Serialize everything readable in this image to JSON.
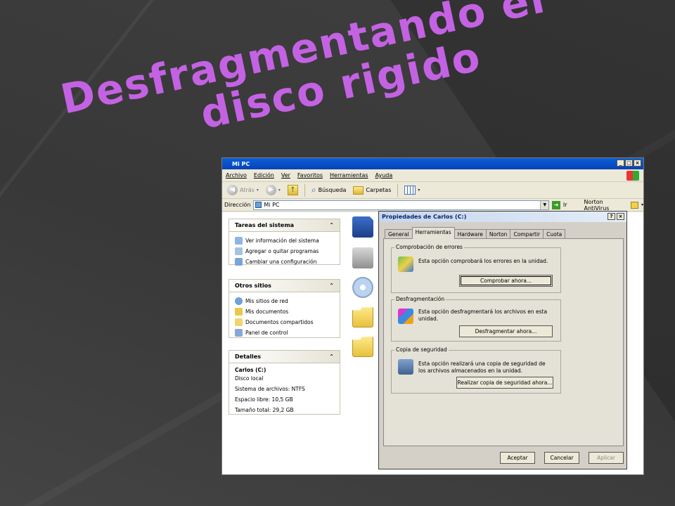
{
  "slide": {
    "title_line1": "Desfragmentando el",
    "title_line2": "disco rigido",
    "accent": "#c462e4"
  },
  "explorer": {
    "title": "Mi PC",
    "menu": [
      "Archivo",
      "Edición",
      "Ver",
      "Favoritos",
      "Herramientas",
      "Ayuda"
    ],
    "toolbar": {
      "back": "Atrás",
      "search": "Búsqueda",
      "folders": "Carpetas"
    },
    "address": {
      "label": "Dirección",
      "value": "Mi PC",
      "go": "Ir",
      "antivirus": "Norton AntiVirus"
    },
    "tasks": {
      "title": "Tareas del sistema",
      "items": [
        "Ver información del sistema",
        "Agregar o quitar programas",
        "Cambiar una configuración"
      ]
    },
    "other_places": {
      "title": "Otros sitios",
      "items": [
        "Mis sitios de red",
        "Mis documentos",
        "Documentos compartidos",
        "Panel de control"
      ]
    },
    "details": {
      "title": "Detalles",
      "drive_name": "Carlos (C:)",
      "drive_type": "Disco local",
      "filesystem": "Sistema de archivos: NTFS",
      "free": "Espacio libre: 10,5 GB",
      "total": "Tamaño total: 29,2 GB"
    }
  },
  "dialog": {
    "title": "Propiedades de Carlos (C:)",
    "tabs": [
      "General",
      "Herramientas",
      "Hardware",
      "Norton",
      "Compartir",
      "Cuota"
    ],
    "active_tab": "Herramientas",
    "error_check": {
      "title": "Comprobación de errores",
      "text": "Esta opción comprobará los errores en la unidad.",
      "button": "Comprobar ahora..."
    },
    "defrag": {
      "title": "Desfragmentación",
      "text": "Esta opción desfragmentará los archivos en esta unidad.",
      "button": "Desfragmentar ahora..."
    },
    "backup": {
      "title": "Copia de seguridad",
      "text": "Esta opción realizará una copia de seguridad de los archivos almacenados en la unidad.",
      "button": "Realizar copia de seguridad ahora..."
    },
    "buttons": {
      "ok": "Aceptar",
      "cancel": "Cancelar",
      "apply": "Aplicar"
    }
  }
}
